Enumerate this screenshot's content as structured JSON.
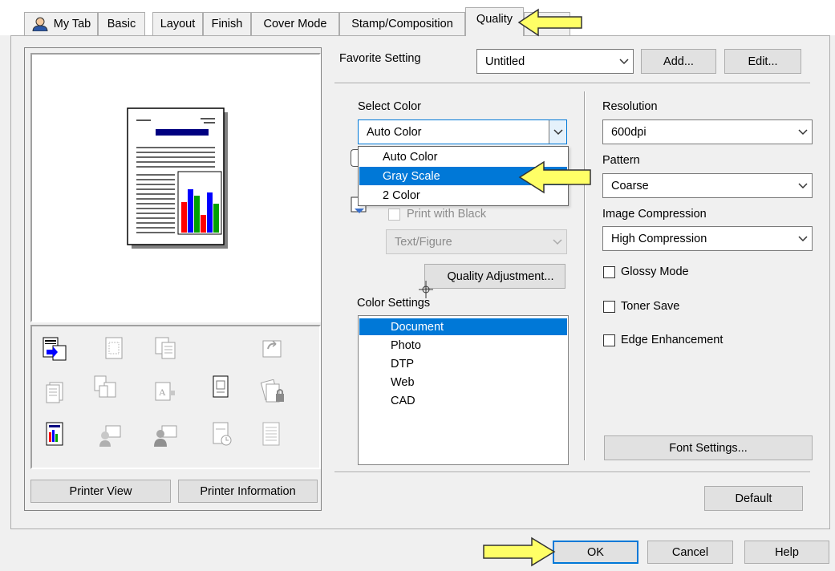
{
  "tabs": [
    {
      "label": "My Tab"
    },
    {
      "label": "Basic"
    },
    {
      "label": "Layout"
    },
    {
      "label": "Finish"
    },
    {
      "label": "Cover Mode"
    },
    {
      "label": "Stamp/Composition"
    },
    {
      "label": "Quality"
    }
  ],
  "favorite": {
    "label": "Favorite Setting",
    "value": "Untitled",
    "add_label": "Add...",
    "edit_label": "Edit..."
  },
  "select_color": {
    "label": "Select Color",
    "value": "Auto Color",
    "options": [
      "Auto Color",
      "Gray Scale",
      "2 Color"
    ],
    "highlighted": "Gray Scale"
  },
  "print_with_black": {
    "label": "Print with Black",
    "checked": false
  },
  "text_figure": {
    "value": "Text/Figure"
  },
  "quality_adjustment_label": "Quality Adjustment...",
  "color_settings": {
    "label": "Color Settings",
    "items": [
      "Document",
      "Photo",
      "DTP",
      "Web",
      "CAD"
    ],
    "selected": "Document"
  },
  "resolution": {
    "label": "Resolution",
    "value": "600dpi"
  },
  "pattern": {
    "label": "Pattern",
    "value": "Coarse"
  },
  "image_compression": {
    "label": "Image Compression",
    "value": "High Compression"
  },
  "checkboxes": {
    "glossy_mode": {
      "label": "Glossy Mode",
      "checked": false
    },
    "toner_save": {
      "label": "Toner Save",
      "checked": false
    },
    "edge_enhancement": {
      "label": "Edge Enhancement",
      "checked": false
    }
  },
  "font_settings_label": "Font Settings...",
  "printer_view_label": "Printer View",
  "printer_information_label": "Printer Information",
  "default_label": "Default",
  "footer": {
    "ok_label": "OK",
    "cancel_label": "Cancel",
    "help_label": "Help"
  },
  "colors": {
    "accent": "#0078d7",
    "callout_arrow_fill": "#ffff66",
    "chart_red": "#ff0000",
    "chart_green": "#00a000",
    "chart_blue": "#0000ff",
    "doc_title_bar": "#000080"
  }
}
